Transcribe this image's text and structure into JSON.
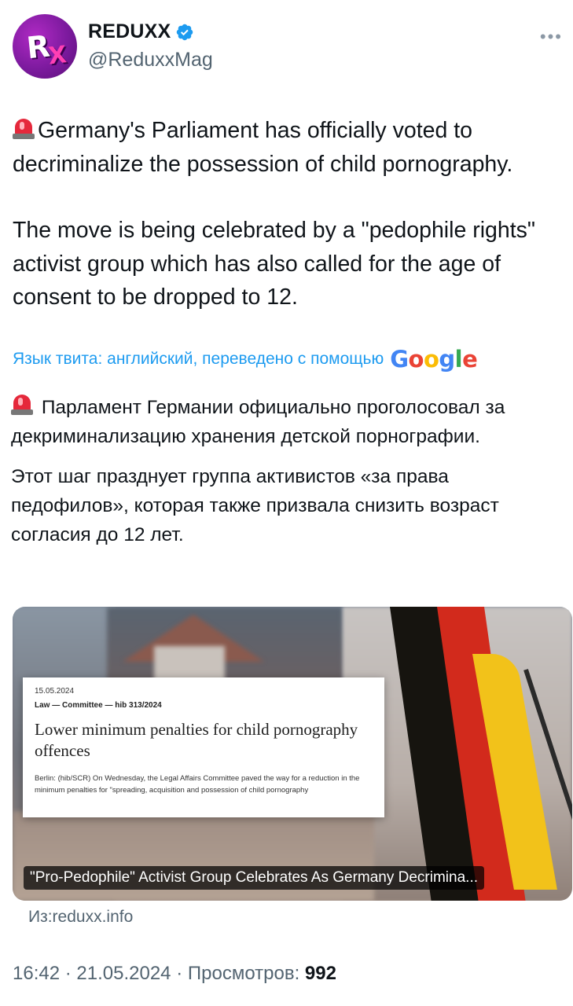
{
  "author": {
    "avatar_text": "RX",
    "display_name": "REDUXX",
    "handle": "@ReduxxMag",
    "verified_icon": "verified-badge-icon",
    "more_icon": "more-dots-icon"
  },
  "tweet": {
    "paragraph_1": "Germany's Parliament has officially voted to decriminalize the possession of child pornography.",
    "paragraph_2": "The move is being celebrated by a \"pedophile rights\" activist group which has also called for the age of consent to be dropped to 12."
  },
  "translation": {
    "label": "Язык твита: английский, переведено с помощью",
    "provider": "Google",
    "paragraph_1": "Парламент Германии официально проголосовал за декриминализацию хранения детской порнографии.",
    "paragraph_2": "Этот шаг празднует группа активистов «за права педофилов», которая также призвала снизить возраст согласия до 12 лет."
  },
  "card": {
    "doc_date": "15.05.2024",
    "doc_category": "Law — Committee — hib 313/2024",
    "doc_title": "Lower minimum penalties for child pornography offences",
    "doc_body": "Berlin: (hib/SCR) On Wednesday, the Legal Affairs Committee paved the way for a reduction in the minimum penalties for \"spreading, acquisition and possession of child pornography",
    "caption": "\"Pro-Pedophile\" Activist Group Celebrates As Germany Decrimina...",
    "source": "Из:reduxx.info"
  },
  "meta": {
    "time": "16:42",
    "date": "21.05.2024",
    "views_label": "Просмотров:",
    "views_count": "992",
    "separator": "·"
  },
  "colors": {
    "link_blue": "#1d9bf0",
    "secondary_text": "#536471",
    "avatar_purple": "#7c1a9e"
  }
}
